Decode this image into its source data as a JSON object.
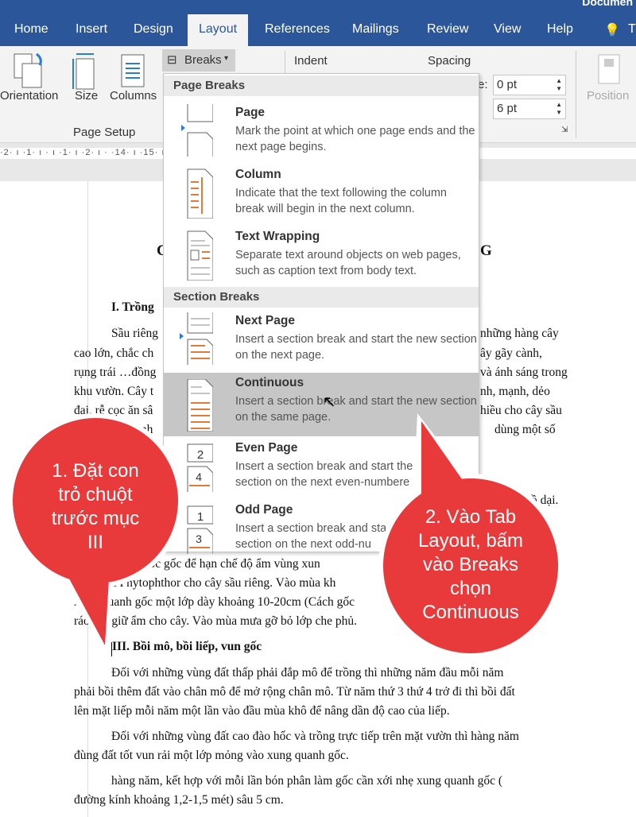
{
  "window": {
    "title_fragment": "Documen"
  },
  "tabs": [
    "Home",
    "Insert",
    "Design",
    "Layout",
    "References",
    "Mailings",
    "Review",
    "View",
    "Help",
    "T"
  ],
  "active_tab": "Layout",
  "ribbon": {
    "orientation": "Orientation",
    "size": "Size",
    "columns": "Columns",
    "breaks": "Breaks",
    "group_page_setup": "Page Setup",
    "indent": "Indent",
    "spacing": "Spacing",
    "before_label": "re:",
    "before_value": "0 pt",
    "after_label": ":",
    "after_value": "6 pt",
    "position": "Position"
  },
  "ruler": "·2· ı ·1· ı ·  ı ·1· ı ·2· ı ·                                                                                   ·14· ı ·15· ı ·16·  ·17· ı ·18·",
  "menu": {
    "page_breaks_header": "Page Breaks",
    "section_breaks_header": "Section Breaks",
    "items": [
      {
        "title": "Page",
        "desc": "Mark the point at which one page ends and the next page begins."
      },
      {
        "title": "Column",
        "desc": "Indicate that the text following the column break will begin in the next column."
      },
      {
        "title": "Text Wrapping",
        "desc": "Separate text around objects on web pages, such as caption text from body text."
      },
      {
        "title": "Next Page",
        "desc": "Insert a section break and start the new section on the next page."
      },
      {
        "title": "Continuous",
        "desc": "Insert a section break and start the new section on the same page."
      },
      {
        "title": "Even Page",
        "desc": "Insert a section break and start the section on the next even-numbere"
      },
      {
        "title": "Odd Page",
        "desc": "Insert a section break and sta section on the next odd-nu"
      }
    ],
    "highlighted": "Continuous",
    "even_icon_numbers": [
      "2",
      "4"
    ],
    "odd_icon_numbers": [
      "1",
      "3"
    ]
  },
  "document": {
    "title_left": "C",
    "title_right": "G",
    "heading1": "I. Trồng",
    "left_lines": [
      "Sầu riêng",
      "cao lớn, chắc ch",
      "rụng trái …đồng",
      "khu vườn. Cây t",
      "đai, rễ cọc ăn sâ",
      "… Theo kinh"
    ],
    "right_lines": [
      "những hàng cây",
      "ây gãy cành,",
      "và ánh sáng trong",
      "nh, mạnh, dẻo",
      "hiều cho cây sầu",
      "dùng một số",
      "ồ dại."
    ],
    "mid_lines": [
      "quanh gốc gốc để hạn chế độ ẩm vùng xun",
      "nấm Phytophthor cho cây sầu riêng. Vào mùa kh",
      "xung quanh gốc một lớp dày khoảng 10-20cm (Cách gốc",
      "ráo) để giữ ẩm cho cây. Vào mùa mưa gỡ bỏ lớp che phủ."
    ],
    "heading3": "III. Bồi mô, bồi liếp, vun gốc",
    "para_lines": [
      "Đối với những vùng đất thấp phải đắp mô để trồng thì những năm đầu mỗi năm",
      "phải bồi thêm đất vào chân mô để mở rộng chân mô. Từ năm thứ 3 thứ 4 trở đi thì bồi đất",
      "lên mặt liếp mỗi năm một lần vào đầu mùa khô để nâng dần độ cao của liếp.",
      "Đối với những vùng đất cao đào hốc và trồng trực tiếp trên mặt vườn thì hàng năm",
      "đùng đất tốt vun rải một lớp mỏng vào xung quanh gốc.",
      "hàng năm, kết hợp với mỗi lần bón phân làm gốc cần xới nhẹ xung quanh gốc (",
      "đường kính khoảng 1,2-1,5 mét) sâu 5 cm."
    ]
  },
  "callouts": {
    "step1": [
      "1. Đặt con",
      "trỏ chuột",
      "trước mục",
      "III"
    ],
    "step2": [
      "2. Vào Tab",
      "Layout, bấm",
      "vào Breaks",
      "chọn",
      "Continuous"
    ],
    "color": "#e8393b"
  }
}
